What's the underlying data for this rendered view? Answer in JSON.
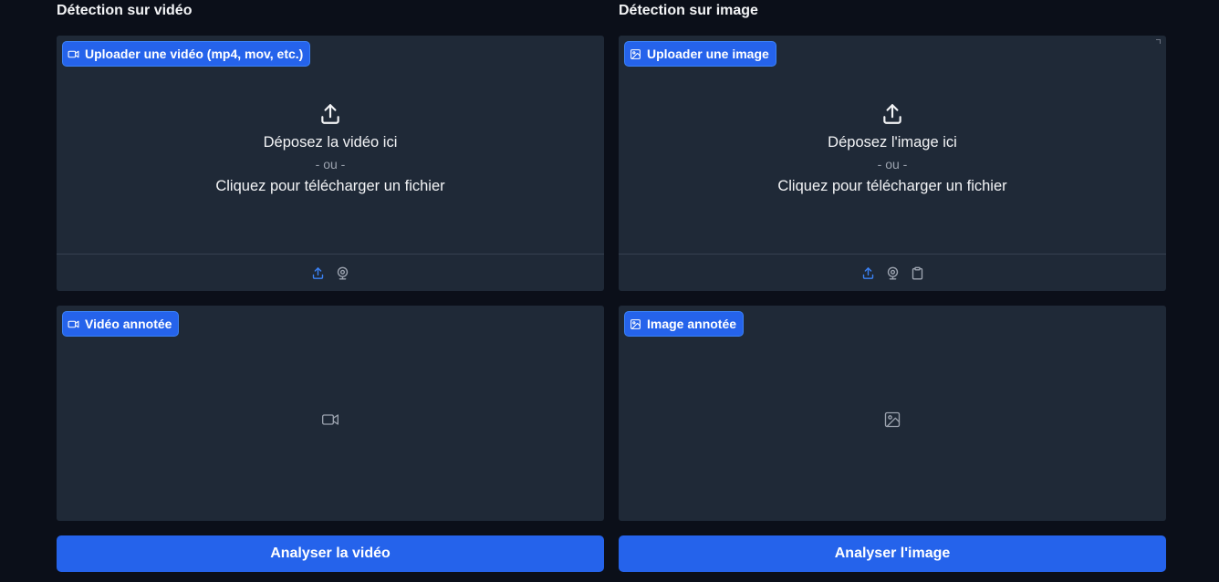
{
  "video": {
    "title": "Détection sur vidéo",
    "upload_badge": "Uploader une vidéo (mp4, mov, etc.)",
    "drop_line1": "Déposez la vidéo ici",
    "drop_line2": "- ou -",
    "drop_line3": "Cliquez pour télécharger un fichier",
    "output_badge": "Vidéo annotée",
    "button_label": "Analyser la vidéo",
    "toolbar_icons": [
      "upload-icon",
      "webcam-icon"
    ],
    "badge_icon": "video-camera-icon",
    "placeholder_icon": "video-camera-icon"
  },
  "image": {
    "title": "Détection sur image",
    "upload_badge": "Uploader une image",
    "drop_line1": "Déposez l'image ici",
    "drop_line2": "- ou -",
    "drop_line3": "Cliquez pour télécharger un fichier",
    "output_badge": "Image annotée",
    "button_label": "Analyser l'image",
    "toolbar_icons": [
      "upload-icon",
      "webcam-icon",
      "clipboard-icon"
    ],
    "badge_icon": "image-icon",
    "placeholder_icon": "image-icon"
  },
  "colors": {
    "background": "#0b0f19",
    "panel": "#1f2937",
    "accent": "#2563eb",
    "active_icon": "#3b82f6",
    "muted_icon": "#9ca3af"
  }
}
